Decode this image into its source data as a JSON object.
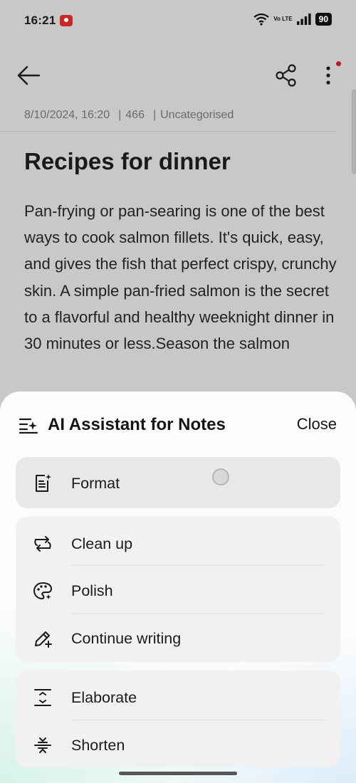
{
  "status_bar": {
    "time": "16:21",
    "network_label": "Vo LTE",
    "battery": "90"
  },
  "toolbar": {
    "back_icon": "arrow-left-icon",
    "share_icon": "share-icon",
    "more_icon": "more-vertical-icon"
  },
  "note": {
    "date": "8/10/2024, 16:20",
    "word_count": "466",
    "category": "Uncategorised",
    "title": "Recipes for dinner",
    "body": "Pan-frying or pan-searing is one of the best ways to cook salmon fillets. It's quick, easy, and gives the fish that perfect crispy, crunchy skin. A simple pan-fried salmon is the secret to a flavorful and healthy weeknight dinner in 30 minutes or less.Season the salmon"
  },
  "sheet": {
    "title": "AI Assistant for Notes",
    "close_label": "Close",
    "title_icon": "ai-list-sparkle-icon",
    "groups": [
      {
        "items": [
          {
            "label": "Format",
            "icon": "format-document-icon"
          }
        ]
      },
      {
        "items": [
          {
            "label": "Clean up",
            "icon": "clean-up-arrows-icon"
          },
          {
            "label": "Polish",
            "icon": "palette-sparkle-icon"
          },
          {
            "label": "Continue writing",
            "icon": "pen-plus-icon"
          }
        ]
      },
      {
        "items": [
          {
            "label": "Elaborate",
            "icon": "expand-icon"
          },
          {
            "label": "Shorten",
            "icon": "shorten-icon"
          }
        ]
      }
    ]
  }
}
